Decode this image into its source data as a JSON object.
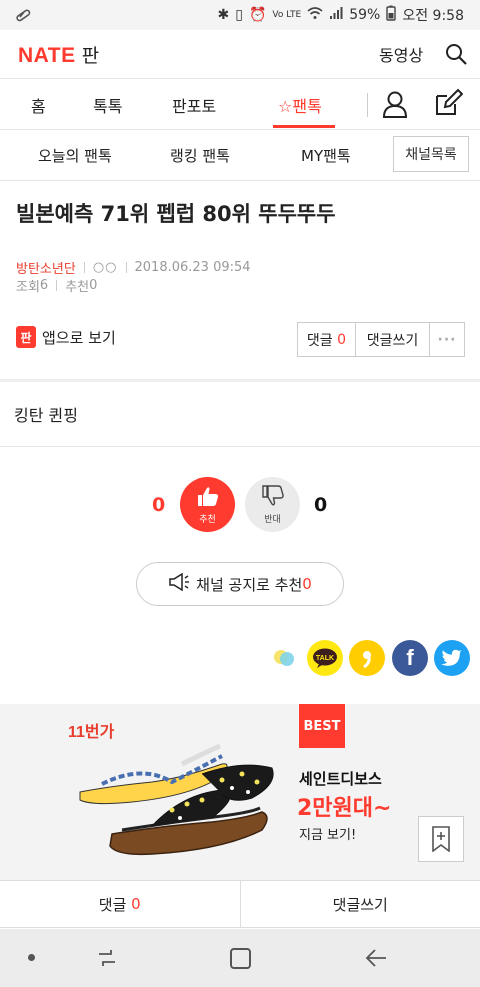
{
  "status_bar": {
    "battery": "59%",
    "time": "오전 9:58",
    "network": "Vo LTE"
  },
  "header": {
    "logo": "NATE",
    "logo_sub": "판",
    "video": "동영상"
  },
  "tabs": [
    {
      "label": "홈"
    },
    {
      "label": "톡톡"
    },
    {
      "label": "판포토"
    },
    {
      "label": "팬톡",
      "active": true
    }
  ],
  "subtabs": [
    {
      "label": "오늘의 팬톡"
    },
    {
      "label": "랭킹 팬톡"
    },
    {
      "label": "MY팬톡"
    }
  ],
  "channel_list": "채널목록",
  "post": {
    "title": "빌본예측 71위 펩럽 80위 뚜두뚜두",
    "author": "방탄소년단",
    "author_mark": "○○",
    "date": "2018.06.23 09:54",
    "views_label": "조회",
    "views": "6",
    "recommend_label": "추천",
    "recommend": "0",
    "body": "킹탄 퀸핑"
  },
  "actions": {
    "app_view": "앱으로 보기",
    "comment_label": "댓글",
    "comment_count": "0",
    "write_comment": "댓글쓰기",
    "more": "···"
  },
  "vote": {
    "up_count": "0",
    "up_label": "추천",
    "down_label": "반대",
    "down_count": "0"
  },
  "channel_recommend": {
    "label": "채널 공지로 추천",
    "count": "0"
  },
  "share": [
    {
      "name": "cyworld",
      "color": "#8dd3e8"
    },
    {
      "name": "kakaotalk",
      "color": "#ffe812",
      "text": "TALK"
    },
    {
      "name": "kakaostory",
      "color": "#ffcd00"
    },
    {
      "name": "facebook",
      "color": "#3b5998",
      "text": "f"
    },
    {
      "name": "twitter",
      "color": "#1da1f2"
    }
  ],
  "ad": {
    "brand": "11번가",
    "badge": "BEST",
    "line1": "세인트디보스",
    "line2": "2만원대~",
    "line3": "지금 보기!"
  },
  "bottom_bar": {
    "comment_label": "댓글",
    "comment_count": "0",
    "write": "댓글쓰기"
  }
}
